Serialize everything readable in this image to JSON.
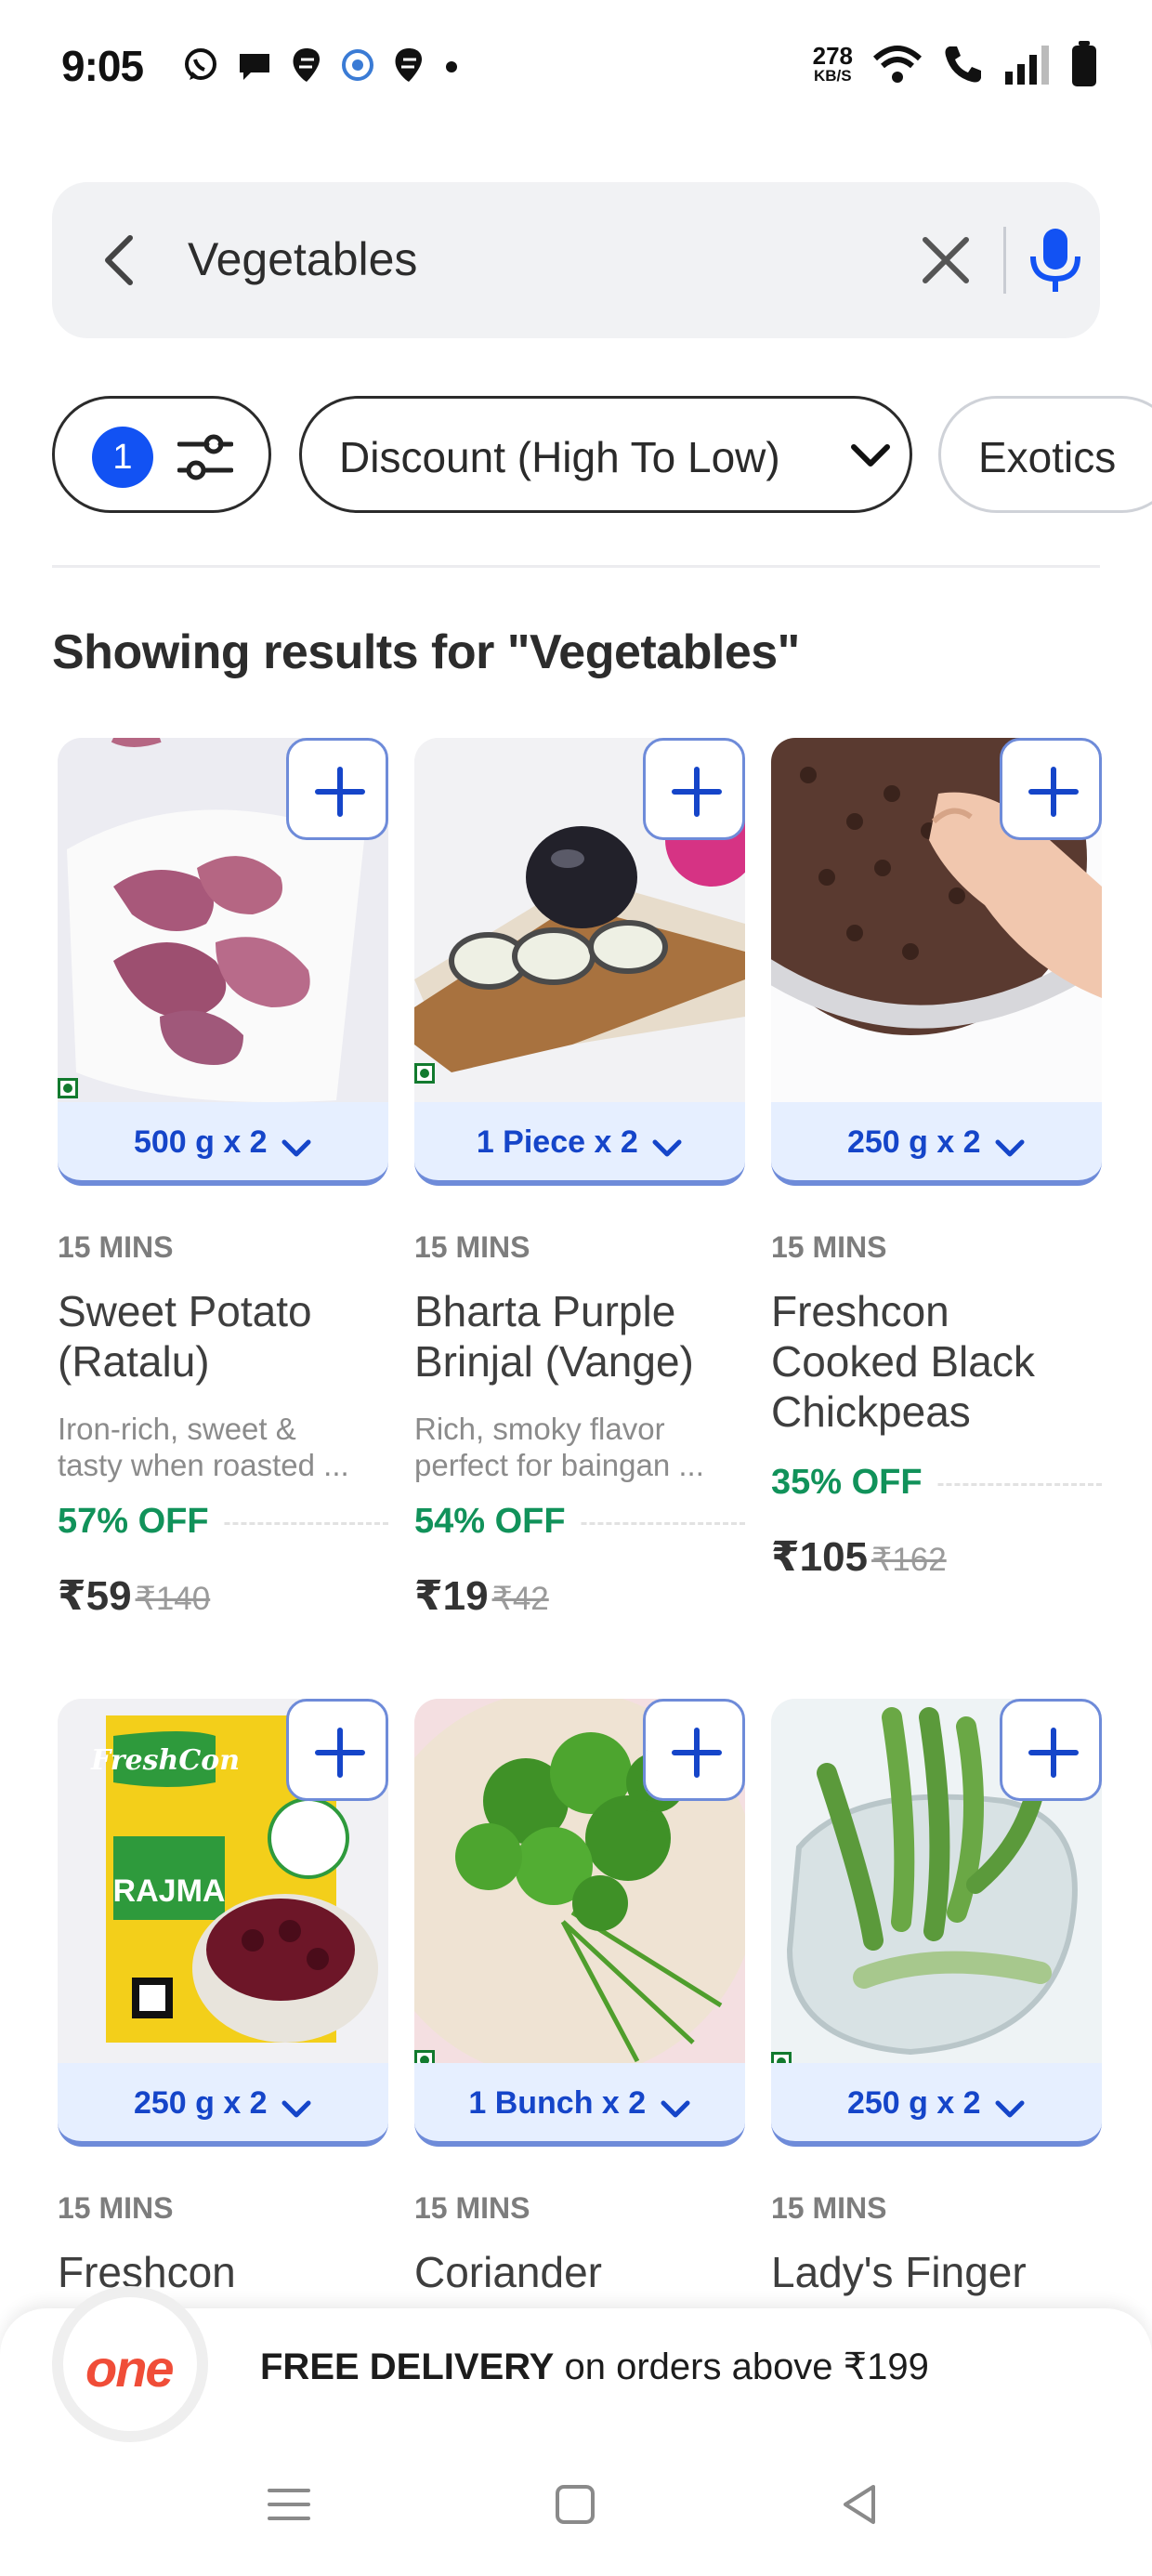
{
  "status_bar": {
    "time": "9:05",
    "net_speed_value": "278",
    "net_speed_unit": "KB/S"
  },
  "search": {
    "query": "Vegetables"
  },
  "filters": {
    "active_count": "1",
    "sort_label": "Discount (High To Low)",
    "category_chip": "Exotics"
  },
  "results_heading": "Showing results for \"Vegetables\"",
  "colors": {
    "accent_blue": "#1252f3",
    "discount_green": "#11925a",
    "brand": "#f04d38"
  },
  "products": [
    {
      "qty": "500 g x 2",
      "eta": "15 MINS",
      "title_1": "Sweet Potato",
      "title_2": "(Ratalu)",
      "desc_1": "Iron-rich, sweet &",
      "desc_2": "tasty when roasted ...",
      "discount": "57% OFF",
      "price": "₹59",
      "mrp": "₹140"
    },
    {
      "qty": "1 Piece x 2",
      "eta": "15 MINS",
      "title_1": "Bharta Purple",
      "title_2": "Brinjal (Vange)",
      "desc_1": "Rich, smoky flavor",
      "desc_2": "perfect for baingan ...",
      "discount": "54% OFF",
      "price": "₹19",
      "mrp": "₹42"
    },
    {
      "qty": "250 g x 2",
      "eta": "15 MINS",
      "title_1": "Freshcon",
      "title_2": "Cooked Black",
      "title_3": "Chickpeas",
      "discount": "35% OFF",
      "price": "₹105",
      "mrp": "₹162"
    },
    {
      "qty": "250 g x 2",
      "eta": "15 MINS",
      "title_1": "Freshcon",
      "package_brand": "FreshCon",
      "package_product": "RAJMA"
    },
    {
      "qty": "1 Bunch x 2",
      "eta": "15 MINS",
      "title_1": "Coriander"
    },
    {
      "qty": "250 g x 2",
      "eta": "15 MINS",
      "title_1": "Lady's Finger"
    }
  ],
  "banner": {
    "logo": "one",
    "bold_text": "FREE DELIVERY",
    "text": " on orders above ₹199"
  }
}
